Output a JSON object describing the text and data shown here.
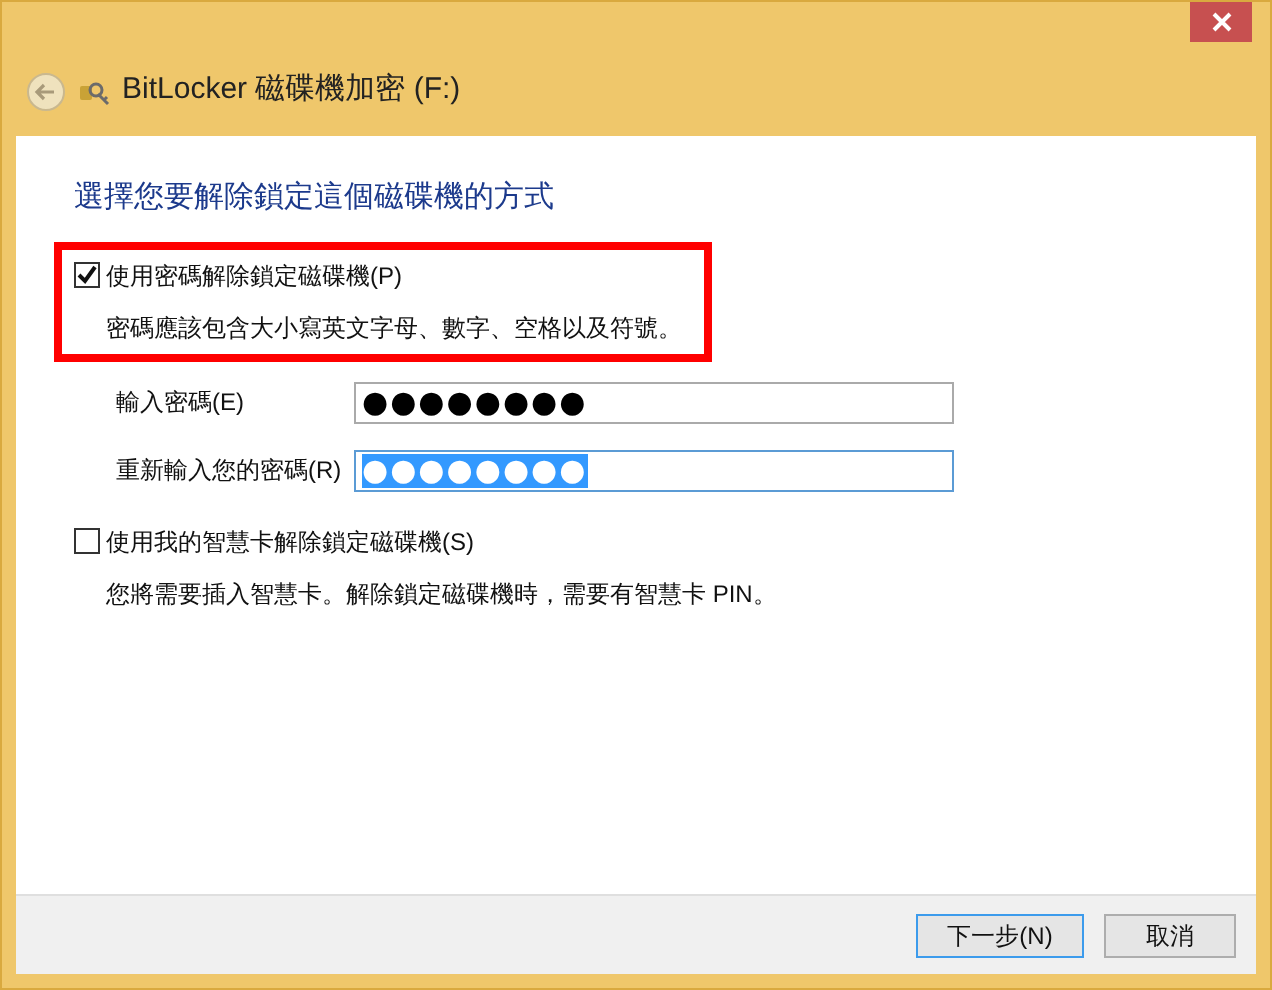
{
  "window": {
    "title": "BitLocker 磁碟機加密 (F:)"
  },
  "heading": "選擇您要解除鎖定這個磁碟機的方式",
  "options": [
    {
      "label": "使用密碼解除鎖定磁碟機(P)",
      "checked": true,
      "highlighted": true,
      "description": "密碼應該包含大小寫英文字母、數字、空格以及符號。",
      "fields": [
        {
          "label": "輸入密碼(E)",
          "value": "●●●●●●●●",
          "focused": false,
          "text_selected": false
        },
        {
          "label": "重新輸入您的密碼(R)",
          "value": "●●●●●●●●",
          "focused": true,
          "text_selected": true
        }
      ]
    },
    {
      "label": "使用我的智慧卡解除鎖定磁碟機(S)",
      "checked": false,
      "highlighted": false,
      "description": "您將需要插入智慧卡。解除鎖定磁碟機時，需要有智慧卡 PIN。"
    }
  ],
  "buttons": [
    {
      "label": "下一步(N)",
      "default": true
    },
    {
      "label": "取消",
      "default": false
    }
  ]
}
